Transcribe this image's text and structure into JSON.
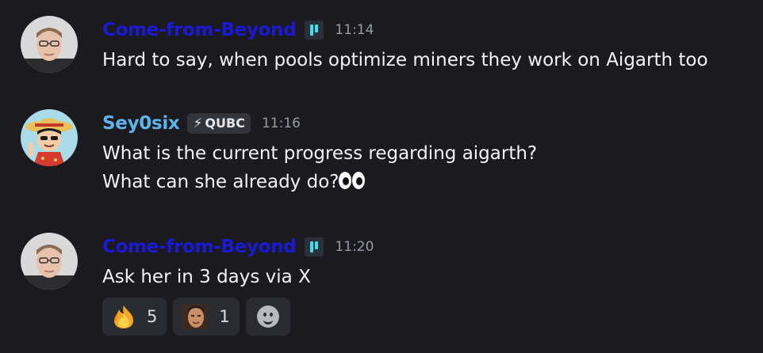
{
  "colors": {
    "background": "#1b1b1f",
    "cfb_name": "#1a1ad6",
    "sey_name": "#5db3ea",
    "timestamp": "#949ba4",
    "text": "#f2f3f5",
    "role_badge_accent": "#36e3f0"
  },
  "messages": [
    {
      "author": "Come-from-Beyond",
      "role_icon": "qubic-logo-icon",
      "time": "11:14",
      "lines": [
        "Hard to say, when pools optimize miners they work on Aigarth too"
      ]
    },
    {
      "author": "Sey0six",
      "tag": {
        "icon": "lightning-bolt-icon",
        "label": "QUBC"
      },
      "time": "11:16",
      "lines": [
        "What is the current progress regarding aigarth?",
        "What can she already do?"
      ],
      "trailing_emoji": "eyes-emoji"
    },
    {
      "author": "Come-from-Beyond",
      "role_icon": "qubic-logo-icon",
      "time": "11:20",
      "lines": [
        "Ask her in 3 days via X"
      ],
      "reactions": [
        {
          "emoji": "fire-emoji",
          "count": "5"
        },
        {
          "emoji": "custom-face-emoji",
          "count": "1"
        }
      ],
      "add_reaction_icon": "add-reaction-smile-icon"
    }
  ]
}
